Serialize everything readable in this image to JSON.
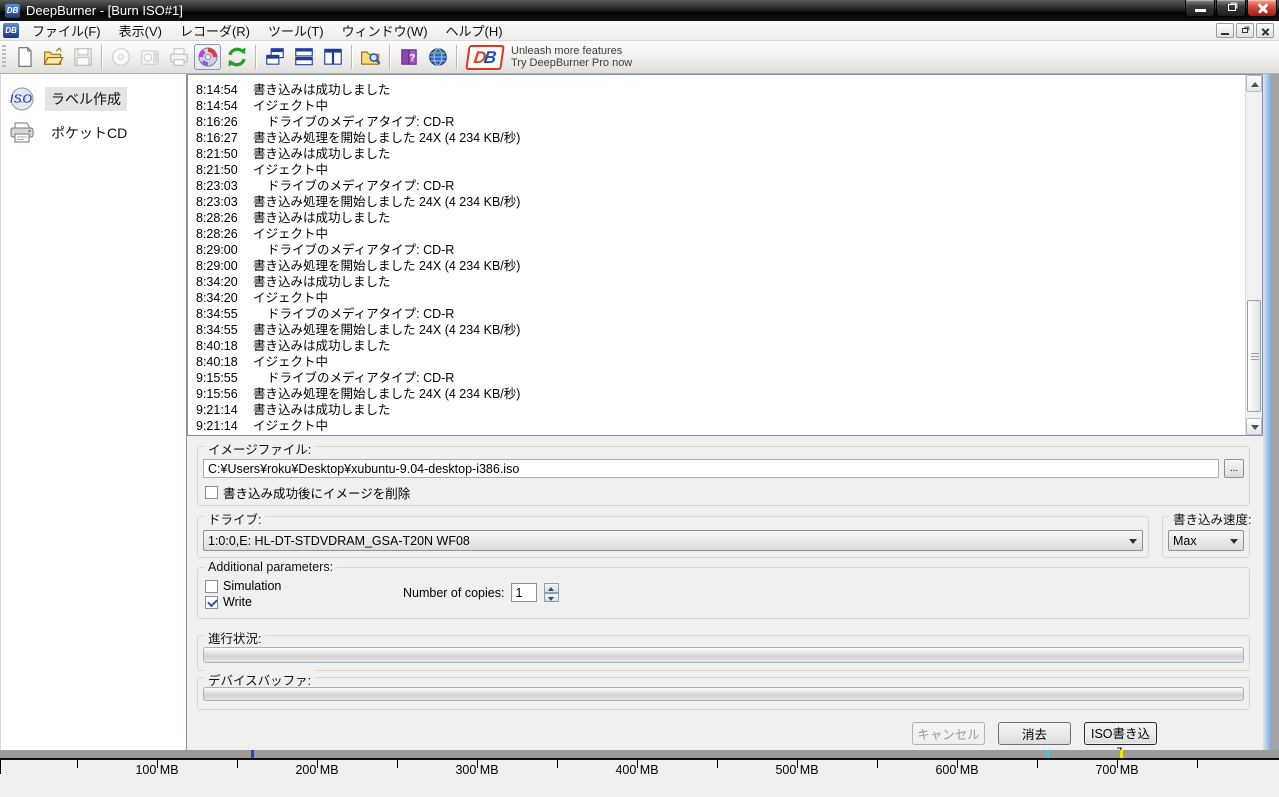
{
  "window": {
    "title": "DeepBurner - [Burn ISO#1]"
  },
  "menu": {
    "items": [
      {
        "label": "ファイル(F)"
      },
      {
        "label": "表示(V)"
      },
      {
        "label": "レコーダ(R)"
      },
      {
        "label": "ツール(T)"
      },
      {
        "label": "ウィンドウ(W)"
      },
      {
        "label": "ヘルプ(H)"
      }
    ]
  },
  "toolbar": {
    "icons": [
      {
        "name": "new-file-icon",
        "disabled": false
      },
      {
        "name": "open-file-icon",
        "disabled": false
      },
      {
        "name": "save-icon",
        "disabled": true
      },
      {
        "name": "separator"
      },
      {
        "name": "erase-disc-icon",
        "disabled": true
      },
      {
        "name": "data-disc-icon",
        "disabled": true
      },
      {
        "name": "print-icon",
        "disabled": true
      },
      {
        "name": "burn-disc-icon",
        "disabled": false,
        "pressed": true
      },
      {
        "name": "refresh-icon",
        "disabled": false
      },
      {
        "name": "separator"
      },
      {
        "name": "cascade-windows-icon",
        "disabled": false
      },
      {
        "name": "tile-horizontal-icon",
        "disabled": false
      },
      {
        "name": "tile-vertical-icon",
        "disabled": false
      },
      {
        "name": "separator"
      },
      {
        "name": "folder-view-icon",
        "disabled": false
      },
      {
        "name": "separator"
      },
      {
        "name": "help-book-icon",
        "disabled": false
      },
      {
        "name": "web-globe-icon",
        "disabled": false
      },
      {
        "name": "separator"
      }
    ],
    "promo": {
      "logo_d": "D",
      "logo_b": "B",
      "line1": "Unleash more features",
      "line2": "Try DeepBurner Pro now"
    }
  },
  "sidebar": {
    "items": [
      {
        "icon": "iso-disc-icon",
        "label": "ラベル作成",
        "selected": true
      },
      {
        "icon": "printer-icon",
        "label": "ポケットCD",
        "selected": false
      }
    ]
  },
  "log": {
    "entries": [
      {
        "time": "8:14:54",
        "message": "書き込みは成功しました",
        "indent": false
      },
      {
        "time": "8:14:54",
        "message": "イジェクト中",
        "indent": false
      },
      {
        "time": "8:16:26",
        "message": "ドライブのメディアタイプ: CD-R",
        "indent": true
      },
      {
        "time": "8:16:27",
        "message": "書き込み処理を開始しました 24X (4 234 KB/秒)",
        "indent": false
      },
      {
        "time": "8:21:50",
        "message": "書き込みは成功しました",
        "indent": false
      },
      {
        "time": "8:21:50",
        "message": "イジェクト中",
        "indent": false
      },
      {
        "time": "8:23:03",
        "message": "ドライブのメディアタイプ: CD-R",
        "indent": true
      },
      {
        "time": "8:23:03",
        "message": "書き込み処理を開始しました 24X (4 234 KB/秒)",
        "indent": false
      },
      {
        "time": "8:28:26",
        "message": "書き込みは成功しました",
        "indent": false
      },
      {
        "time": "8:28:26",
        "message": "イジェクト中",
        "indent": false
      },
      {
        "time": "8:29:00",
        "message": "ドライブのメディアタイプ: CD-R",
        "indent": true
      },
      {
        "time": "8:29:00",
        "message": "書き込み処理を開始しました 24X (4 234 KB/秒)",
        "indent": false
      },
      {
        "time": "8:34:20",
        "message": "書き込みは成功しました",
        "indent": false
      },
      {
        "time": "8:34:20",
        "message": "イジェクト中",
        "indent": false
      },
      {
        "time": "8:34:55",
        "message": "ドライブのメディアタイプ: CD-R",
        "indent": true
      },
      {
        "time": "8:34:55",
        "message": "書き込み処理を開始しました 24X (4 234 KB/秒)",
        "indent": false
      },
      {
        "time": "8:40:18",
        "message": "書き込みは成功しました",
        "indent": false
      },
      {
        "time": "8:40:18",
        "message": "イジェクト中",
        "indent": false
      },
      {
        "time": "9:15:55",
        "message": "ドライブのメディアタイプ: CD-R",
        "indent": true
      },
      {
        "time": "9:15:56",
        "message": "書き込み処理を開始しました 24X (4 234 KB/秒)",
        "indent": false
      },
      {
        "time": "9:21:14",
        "message": "書き込みは成功しました",
        "indent": false
      },
      {
        "time": "9:21:14",
        "message": "イジェクト中",
        "indent": false
      }
    ]
  },
  "form": {
    "image_file": {
      "label": "イメージファイル:",
      "path": "C:¥Users¥roku¥Desktop¥xubuntu-9.04-desktop-i386.iso",
      "browse": "...",
      "delete_after": {
        "label": "書き込み成功後にイメージを削除",
        "checked": false
      }
    },
    "drive": {
      "label": "ドライブ:",
      "value": "1:0:0,E: HL-DT-STDVDRAM_GSA-T20N WF08"
    },
    "speed": {
      "label": "書き込み速度:",
      "value": "Max"
    },
    "additional": {
      "label": "Additional parameters:",
      "simulation": {
        "label": "Simulation",
        "checked": false
      },
      "write": {
        "label": "Write",
        "checked": true
      },
      "copies": {
        "label": "Number of copies:",
        "value": "1"
      }
    },
    "progress": {
      "label": "進行状況:",
      "percent": 0
    },
    "buffer": {
      "label": "デバイスバッファ:",
      "percent": 0
    },
    "buttons": {
      "cancel": {
        "label": "キャンセル",
        "disabled": true
      },
      "erase": {
        "label": "消去",
        "disabled": false
      },
      "burn": {
        "label": "ISO書き込み",
        "default": true
      }
    }
  },
  "ruler": {
    "unit": "MB",
    "labels": [
      "100 MB",
      "200 MB",
      "300 MB",
      "400 MB",
      "500 MB",
      "600 MB",
      "700 MB"
    ],
    "markers": [
      {
        "color": "#2244dd",
        "mb": 159
      },
      {
        "color": "#00e5e5",
        "mb": 656
      },
      {
        "color": "#ffe100",
        "mb": 702
      }
    ]
  }
}
